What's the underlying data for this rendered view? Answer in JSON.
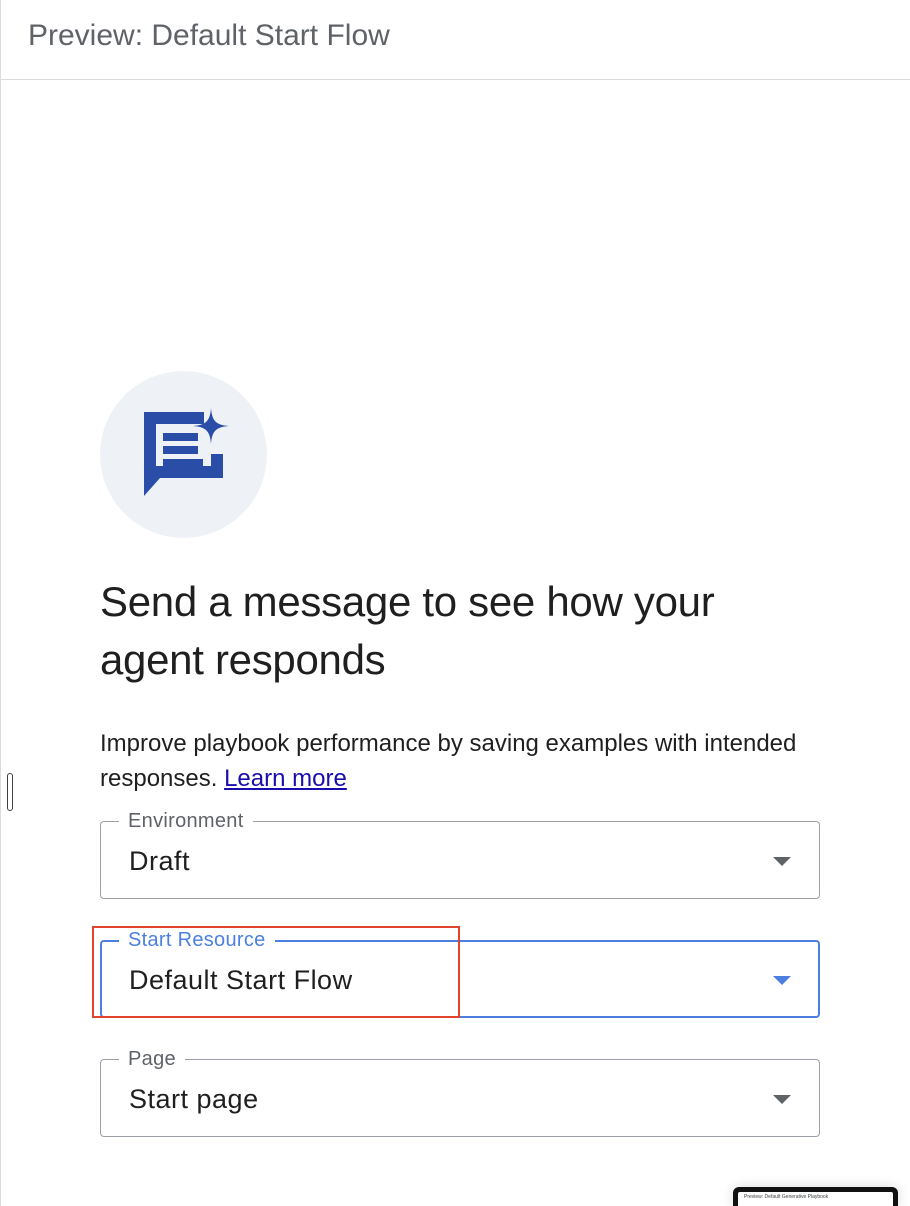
{
  "header": {
    "title": "Preview: Default Start Flow"
  },
  "empty_state": {
    "icon": "chat-sparkle-icon",
    "headline": "Send a message to see how your agent responds",
    "description": "Improve playbook performance by saving examples with intended responses.",
    "learn_more_label": "Learn more"
  },
  "fields": {
    "environment": {
      "label": "Environment",
      "value": "Draft"
    },
    "start_resource": {
      "label": "Start Resource",
      "value": "Default Start Flow"
    },
    "page": {
      "label": "Page",
      "value": "Start page"
    }
  },
  "thumbnail": {
    "title": "Preview: Default Generative Playbook"
  },
  "colors": {
    "accent": "#4c7fe0",
    "icon": "#2a4ea8",
    "icon_bg": "#eef1f6",
    "highlight": "#e0442c",
    "link": "#1a0dab"
  }
}
